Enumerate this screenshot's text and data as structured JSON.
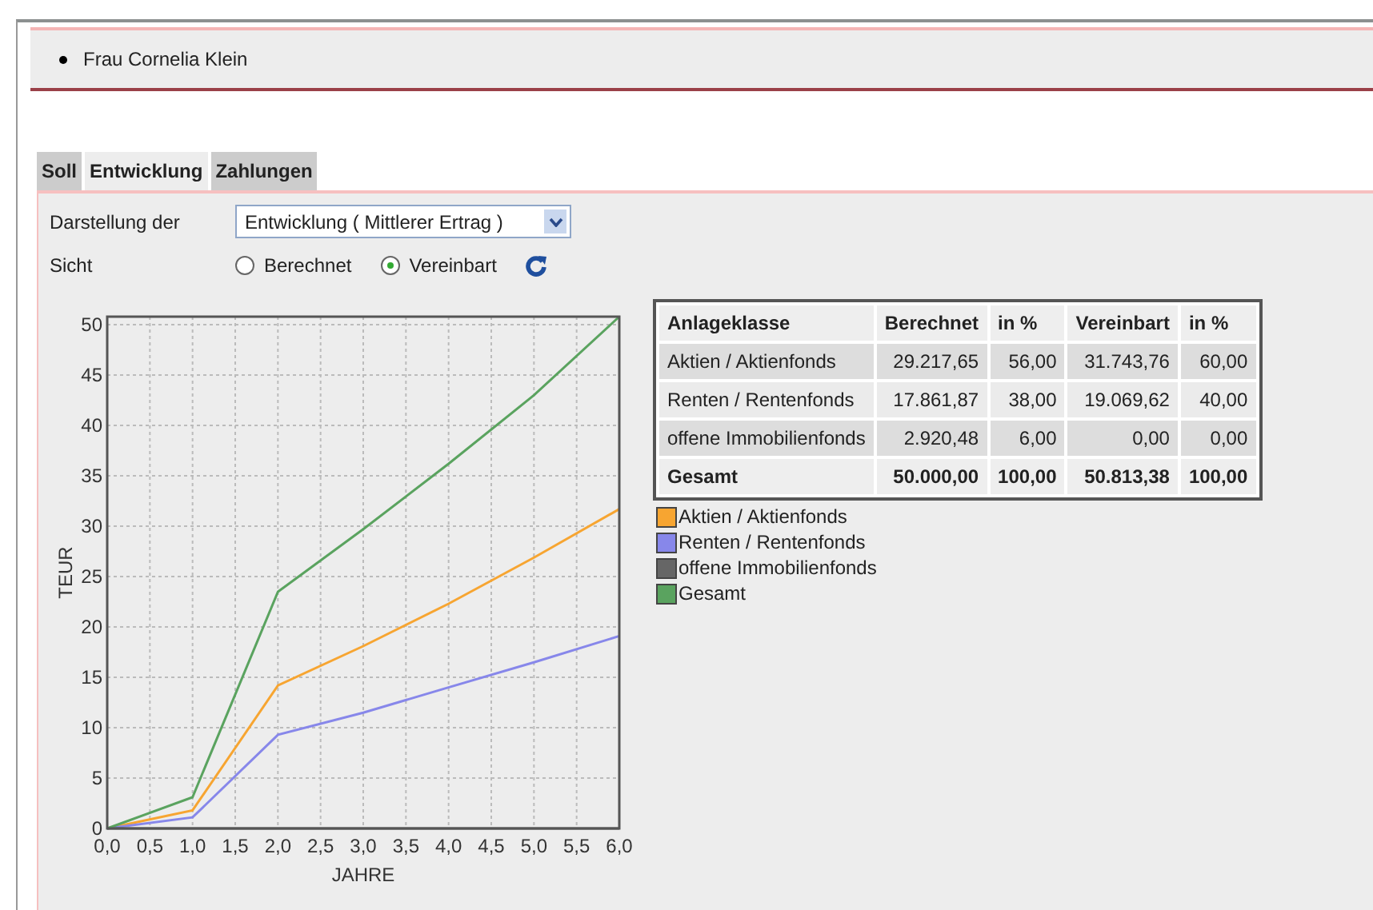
{
  "person": {
    "name": "Frau Cornelia Klein"
  },
  "tabs": [
    {
      "label": "Soll",
      "selected": false
    },
    {
      "label": "Entwicklung",
      "selected": true
    },
    {
      "label": "Zahlungen",
      "selected": false
    }
  ],
  "form": {
    "display_label": "Darstellung der",
    "display_value": "Entwicklung ( Mittlerer Ertrag )",
    "view_label": "Sicht",
    "view_options": [
      {
        "label": "Berechnet",
        "selected": false
      },
      {
        "label": "Vereinbart",
        "selected": true
      }
    ]
  },
  "table": {
    "columns": [
      "Anlageklasse",
      "Berechnet",
      "in %",
      "Vereinbart",
      "in %"
    ],
    "rows": [
      {
        "kind": "data",
        "cells": [
          "Aktien / Aktienfonds",
          "29.217,65",
          "56,00",
          "31.743,76",
          "60,00"
        ]
      },
      {
        "kind": "data",
        "cells": [
          "Renten / Rentenfonds",
          "17.861,87",
          "38,00",
          "19.069,62",
          "40,00"
        ]
      },
      {
        "kind": "data",
        "cells": [
          "offene Immobilienfonds",
          "2.920,48",
          "6,00",
          "0,00",
          "0,00"
        ]
      },
      {
        "kind": "total",
        "cells": [
          "Gesamt",
          "50.000,00",
          "100,00",
          "50.813,38",
          "100,00"
        ]
      }
    ]
  },
  "chart_data": {
    "type": "line",
    "xlabel": "JAHRE",
    "ylabel": "TEUR",
    "x": [
      0,
      1,
      2,
      3,
      4,
      5,
      6
    ],
    "grid": true,
    "series": [
      {
        "name": "Aktien / Aktienfonds",
        "color": "#f7a531",
        "values": [
          0,
          1.8,
          14.2,
          18.1,
          22.3,
          26.9,
          31.7
        ]
      },
      {
        "name": "Renten / Rentenfonds",
        "color": "#8787ea",
        "values": [
          0,
          1.1,
          9.3,
          11.5,
          14,
          16.5,
          19.1
        ]
      },
      {
        "name": "offene Immobilienfonds",
        "color": "#666666",
        "values": [
          0,
          0,
          0,
          0,
          0,
          0,
          0
        ]
      },
      {
        "name": "Gesamt",
        "color": "#5aa35f",
        "values": [
          0,
          3.1,
          23.5,
          29.7,
          36.2,
          43,
          50.8
        ]
      }
    ],
    "xlim": [
      0,
      6
    ],
    "ylim": [
      0,
      50.8
    ],
    "xticks": [
      {
        "value": 0,
        "label": "0,0"
      },
      {
        "value": 0.5,
        "label": "0,5"
      },
      {
        "value": 1,
        "label": "1,0"
      },
      {
        "value": 1.5,
        "label": "1,5"
      },
      {
        "value": 2,
        "label": "2,0"
      },
      {
        "value": 2.5,
        "label": "2,5"
      },
      {
        "value": 3,
        "label": "3,0"
      },
      {
        "value": 3.5,
        "label": "3,5"
      },
      {
        "value": 4,
        "label": "4,0"
      },
      {
        "value": 4.5,
        "label": "4,5"
      },
      {
        "value": 5,
        "label": "5,0"
      },
      {
        "value": 5.5,
        "label": "5,5"
      },
      {
        "value": 6,
        "label": "6,0"
      }
    ],
    "yticks": [
      0,
      5,
      10,
      15,
      20,
      25,
      30,
      35,
      40,
      45,
      50
    ]
  }
}
